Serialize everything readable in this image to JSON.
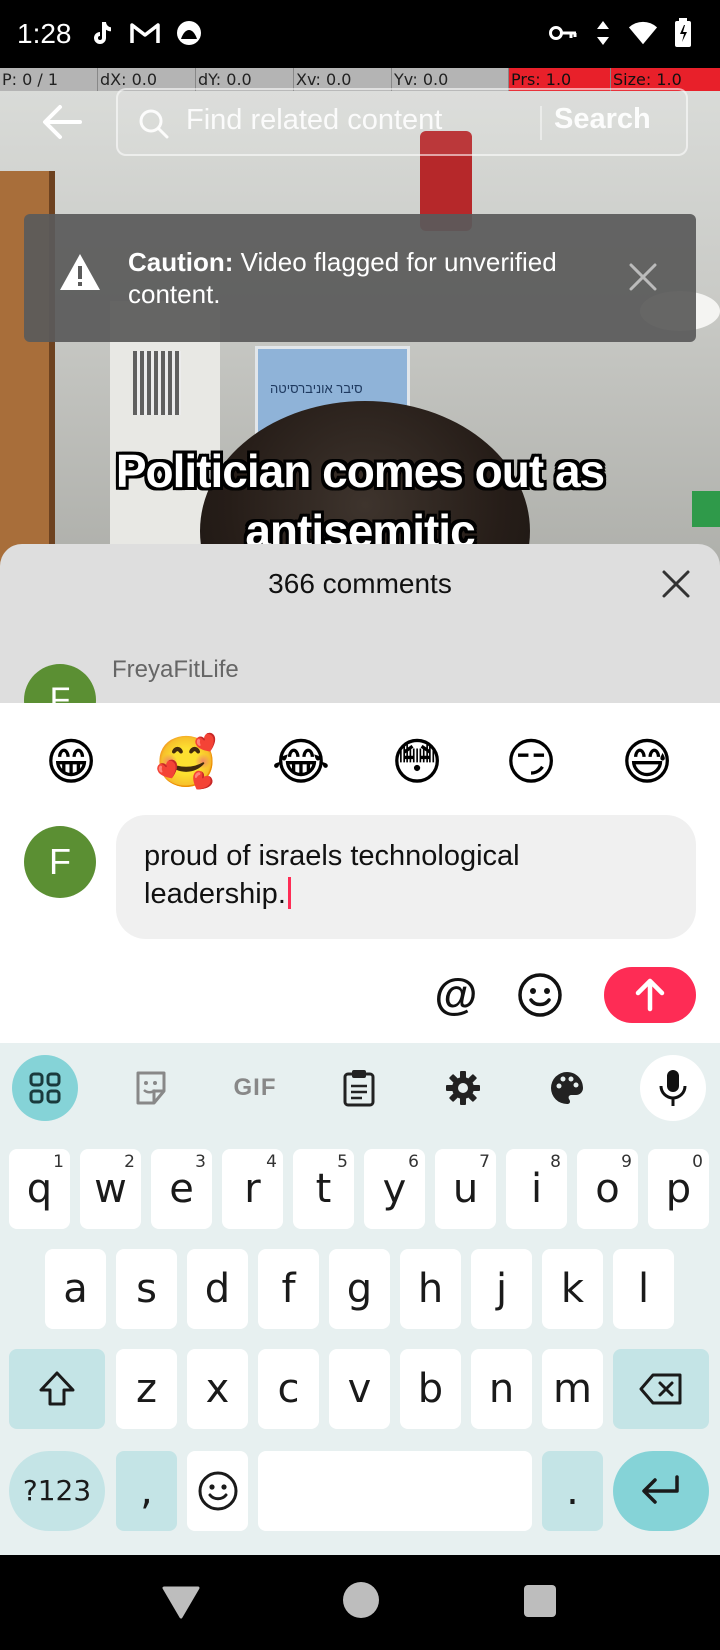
{
  "status_bar": {
    "time": "1:28",
    "left_icons": [
      "tiktok-icon",
      "gmail-icon",
      "app-icon"
    ],
    "right_icons": [
      "vpn-key-icon",
      "data-arrows-icon",
      "wifi-icon",
      "battery-icon"
    ]
  },
  "debug_bar": {
    "p": "P: 0 / 1",
    "dx": "dX: 0.0",
    "dy": "dY: 0.0",
    "xv": "Xv: 0.0",
    "yv": "Yv: 0.0",
    "prs": "Prs: 1.0",
    "size": "Size: 1.0"
  },
  "search": {
    "placeholder": "Find related content",
    "button_label": "Search"
  },
  "caution": {
    "label": "Caution:",
    "message": " Video flagged for unverified content."
  },
  "video": {
    "caption": "Politician comes out as antisemitic",
    "sign_text": "סיבר אוניברסיטה"
  },
  "comments": {
    "title": "366 comments",
    "first_comment": {
      "avatar_letter": "F",
      "username": "FreyaFitLife"
    }
  },
  "composer": {
    "quick_emojis": [
      "😁",
      "🥰",
      "😂",
      "😳",
      "😏",
      "😅"
    ],
    "avatar_letter": "F",
    "input_value": "proud of israels technological leadership.",
    "mention_symbol": "@"
  },
  "keyboard": {
    "toolbar": {
      "gif_label": "GIF"
    },
    "row1": [
      {
        "key": "q",
        "hint": "1"
      },
      {
        "key": "w",
        "hint": "2"
      },
      {
        "key": "e",
        "hint": "3"
      },
      {
        "key": "r",
        "hint": "4"
      },
      {
        "key": "t",
        "hint": "5"
      },
      {
        "key": "y",
        "hint": "6"
      },
      {
        "key": "u",
        "hint": "7"
      },
      {
        "key": "i",
        "hint": "8"
      },
      {
        "key": "o",
        "hint": "9"
      },
      {
        "key": "p",
        "hint": "0"
      }
    ],
    "row2": [
      "a",
      "s",
      "d",
      "f",
      "g",
      "h",
      "j",
      "k",
      "l"
    ],
    "row3": [
      "z",
      "x",
      "c",
      "v",
      "b",
      "n",
      "m"
    ],
    "symbols_label": "?123",
    "comma": ",",
    "period": "."
  }
}
